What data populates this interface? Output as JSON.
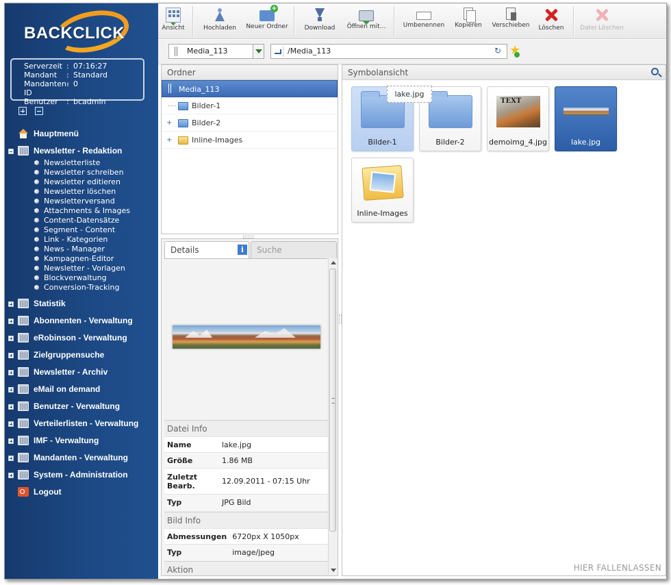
{
  "brand": {
    "logo_text": "BACKCLICK",
    "accent": "#f29c1f",
    "sidebar_bg": "#1d4a86"
  },
  "server_info": [
    {
      "key": "Serverzeit",
      "value": "07:16:27"
    },
    {
      "key": "Mandant",
      "value": "Standard"
    },
    {
      "key": "Mandanten-ID",
      "value": "0"
    },
    {
      "key": "Benutzer",
      "value": "bcadmin"
    }
  ],
  "nav": {
    "home": "Hauptmenü",
    "newsletter_redaktion": {
      "label": "Newsletter - Redaktion",
      "items": [
        "Newsletterliste",
        "Newsletter schreiben",
        "Newsletter editieren",
        "Newsletter löschen",
        "Newsletterversand",
        "Attachments & Images",
        "Content-Datensätze",
        "Segment - Content",
        "Link - Kategorien",
        "News - Manager",
        "Kampagnen-Editor",
        "Newsletter - Vorlagen",
        "Blockverwaltung",
        "Conversion-Tracking"
      ]
    },
    "sections": [
      "Statistik",
      "Abonnenten - Verwaltung",
      "eRobinson - Verwaltung",
      "Zielgruppensuche",
      "Newsletter - Archiv",
      "eMail on demand",
      "Benutzer - Verwaltung",
      "Verteilerlisten - Verwaltung",
      "IMF - Verwaltung",
      "Mandanten - Verwaltung",
      "System - Administration"
    ],
    "logout": "Logout"
  },
  "toolbar": {
    "view": "Ansicht",
    "upload": "Hochladen",
    "new_folder": "Neuer Ordner",
    "download": "Download",
    "open_with": "Öffnen mit...",
    "rename": "Umbenennen",
    "copy": "Kopieren",
    "move": "Verschieben",
    "delete": "Löschen",
    "delete_file": "Datei Löschen"
  },
  "pathbar": {
    "media": "Media_113",
    "path": "/Media_113"
  },
  "folders": {
    "header": "Ordner",
    "root": "Media_113",
    "children": [
      "Bilder-1",
      "Bilder-2",
      "Inline-Images"
    ]
  },
  "details": {
    "tab_details": "Details",
    "tab_search": "Suche",
    "file_info_header": "Datei Info",
    "file_info": [
      {
        "key": "Name",
        "value": "lake.jpg"
      },
      {
        "key": "Größe",
        "value": "1.86 MB"
      },
      {
        "key": "Zuletzt Bearb.",
        "value": "12.09.2011 - 07:15 Uhr"
      },
      {
        "key": "Typ",
        "value": "JPG Bild"
      }
    ],
    "image_info_header": "Bild Info",
    "image_info": [
      {
        "key": "Abmessungen",
        "value": "6720px X 1050px"
      },
      {
        "key": "Typ",
        "value": "image/jpeg"
      }
    ],
    "action_header": "Aktion"
  },
  "icon_view": {
    "header": "Symbolansicht",
    "tiles": [
      "Bilder-1",
      "Bilder-2",
      "demoimg_4.jpg",
      "lake.jpg",
      "Inline-Images"
    ],
    "thumb_text": "TEXT",
    "drag_label": "lake.jpg",
    "drop_zone": "HIER FALLENLASSEN"
  }
}
